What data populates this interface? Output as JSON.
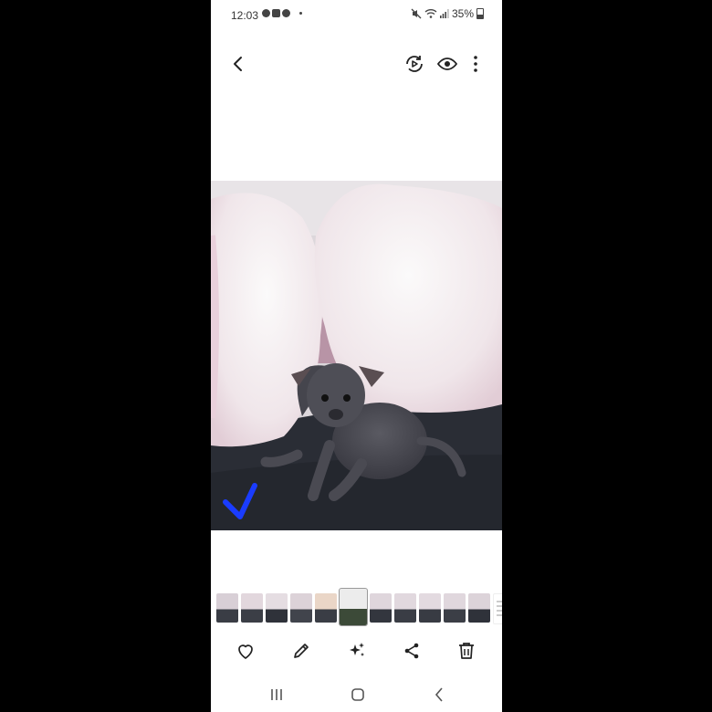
{
  "status_bar": {
    "time": "12:03",
    "battery": "35%",
    "notification_icons": [
      "messenger-icon",
      "gallery-icon",
      "messenger-icon"
    ],
    "system_icons": [
      "mute-icon",
      "wifi-icon",
      "signal-icon",
      "battery-icon"
    ]
  },
  "top_bar": {
    "icons": [
      "back-icon",
      "motion-photo-icon",
      "view-icon",
      "more-options-icon"
    ]
  },
  "photo": {
    "subject": "puppy",
    "overlay_icon": "checkmark-icon",
    "overlay_color": "#1a3cff"
  },
  "filmstrip": {
    "count": 12,
    "selected_index": 5
  },
  "bottom_toolbar": {
    "icons": [
      "favorite-icon",
      "edit-icon",
      "enhance-icon",
      "share-icon",
      "delete-icon"
    ]
  },
  "nav_bar": {
    "icons": [
      "recents-icon",
      "home-icon",
      "back-nav-icon"
    ]
  }
}
